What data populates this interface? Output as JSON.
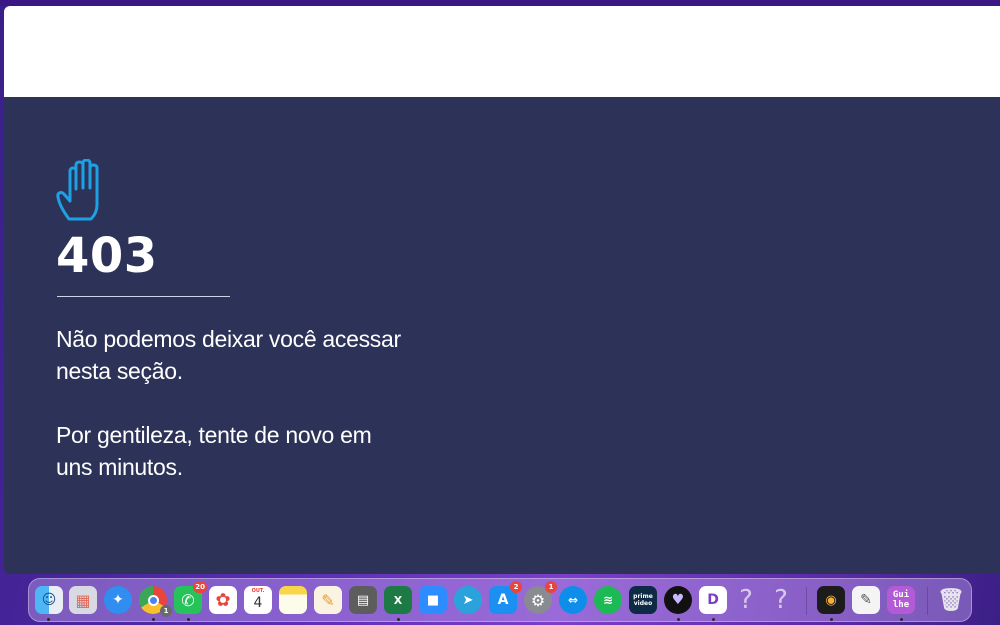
{
  "error_page": {
    "code": "403",
    "message_line1": "Não podemos deixar você acessar",
    "message_line2": "nesta seção.",
    "message_line3": "Por gentileza, tente de novo em",
    "message_line4": "uns minutos.",
    "icon": "raised-hand-icon",
    "accent_color": "#1da1e3",
    "background_color": "#2d3358"
  },
  "dock": {
    "items": [
      {
        "name": "finder",
        "icon": "finder-icon",
        "running": true
      },
      {
        "name": "launchpad",
        "icon": "launchpad-icon",
        "running": false
      },
      {
        "name": "safari",
        "icon": "safari-icon",
        "running": false
      },
      {
        "name": "chrome",
        "icon": "chrome-icon",
        "running": true,
        "badge": "1"
      },
      {
        "name": "whatsapp",
        "icon": "whatsapp-icon",
        "running": true,
        "badge": "20"
      },
      {
        "name": "photos",
        "icon": "photos-icon",
        "running": false
      },
      {
        "name": "calendar",
        "icon": "calendar-icon",
        "running": false,
        "month": "OUT.",
        "day": "4"
      },
      {
        "name": "notes",
        "icon": "notes-icon",
        "running": false
      },
      {
        "name": "pages",
        "icon": "pages-icon",
        "running": false
      },
      {
        "name": "calculator",
        "icon": "calculator-icon",
        "running": false
      },
      {
        "name": "excel",
        "icon": "excel-icon",
        "running": true
      },
      {
        "name": "zoom",
        "icon": "zoom-icon",
        "running": false
      },
      {
        "name": "telegram",
        "icon": "telegram-icon",
        "running": false
      },
      {
        "name": "app-store",
        "icon": "app-store-icon",
        "running": false,
        "badge": "2"
      },
      {
        "name": "system-preferences",
        "icon": "gear-icon",
        "running": false,
        "badge": "1"
      },
      {
        "name": "teamviewer",
        "icon": "teamviewer-icon",
        "running": false
      },
      {
        "name": "spotify",
        "icon": "spotify-icon",
        "running": false
      },
      {
        "name": "prime-video",
        "icon": "prime-video-icon",
        "running": false,
        "label": "prime video"
      },
      {
        "name": "app-heart",
        "icon": "heart-app-icon",
        "running": true
      },
      {
        "name": "app-d",
        "icon": "d-app-icon",
        "running": true
      },
      {
        "name": "unknown-1",
        "icon": "question-icon",
        "running": false,
        "label": "?"
      },
      {
        "name": "unknown-2",
        "icon": "question-icon",
        "running": false,
        "label": "?"
      },
      {
        "name": "preview",
        "icon": "preview-icon",
        "running": true
      },
      {
        "name": "textedit",
        "icon": "textedit-icon",
        "running": false
      },
      {
        "name": "guilhe",
        "icon": "guilhe-icon",
        "running": true,
        "label": "Gui\nlhe"
      },
      {
        "name": "trash",
        "icon": "trash-icon",
        "running": false
      }
    ]
  }
}
